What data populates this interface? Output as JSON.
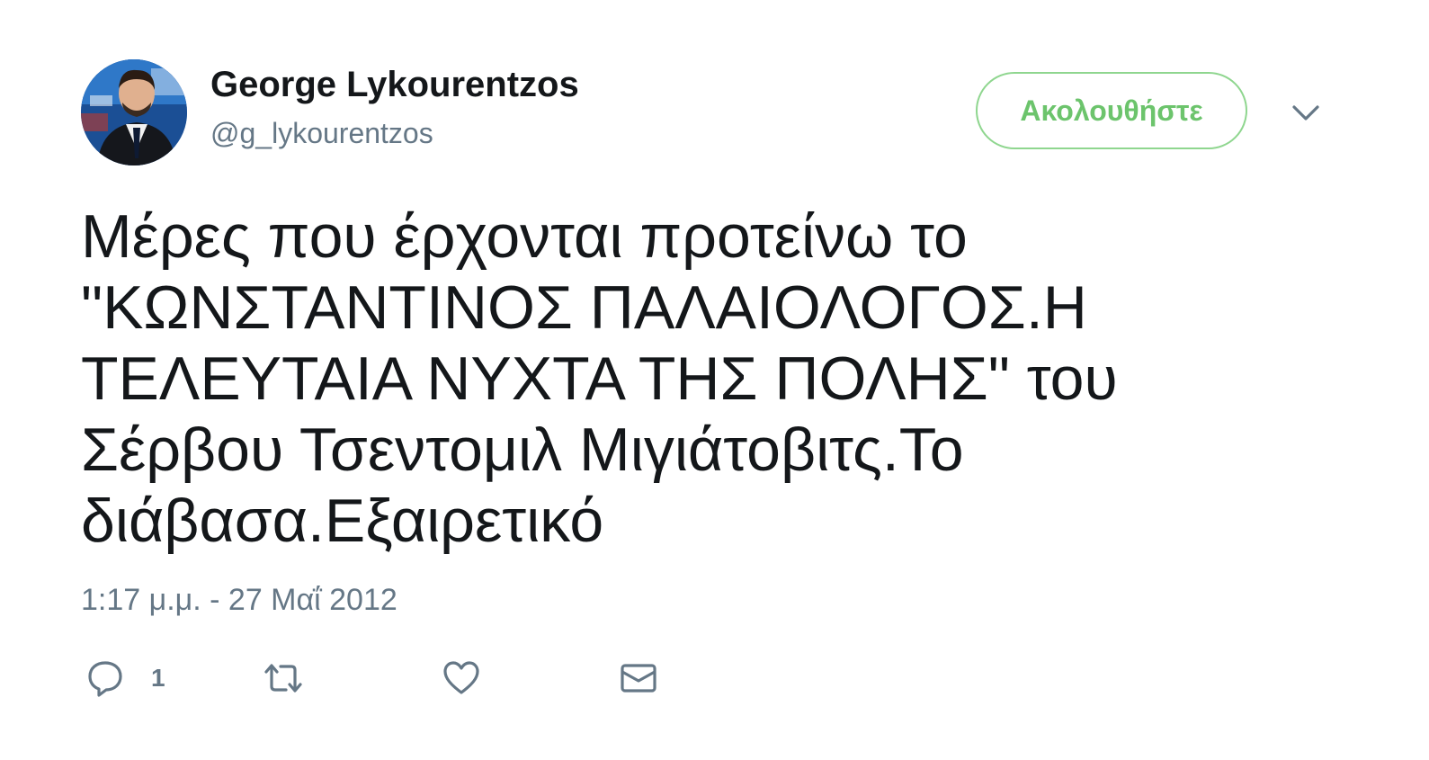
{
  "author": {
    "display_name": "George Lykourentzos",
    "handle": "@g_lykourentzos"
  },
  "header": {
    "follow_label": "Ακολουθήστε",
    "menu_icon": "chevron-down-icon"
  },
  "tweet": {
    "text": "Μέρες που έρχονται προτείνω το\n\"ΚΩΝΣΤΑΝΤΙΝΟΣ ΠΑΛΑΙΟΛΟΓΟΣ.Η\nΤΕΛΕΥΤΑΙΑ ΝΥΧΤΑ ΤΗΣ ΠΟΛΗΣ\" του\nΣέρβου Τσεντομιλ Μιγιάτοβιτς.Το\nδιάβασα.Εξαιρετικό",
    "timestamp": "1:17 μ.μ. - 27 Μαΐ 2012"
  },
  "actions": {
    "reply_count": "1",
    "icons": [
      "reply-icon",
      "retweet-icon",
      "like-icon",
      "message-icon"
    ]
  },
  "colors": {
    "text": "#14171a",
    "secondary": "#657786",
    "follow_accent": "#6cc46c"
  }
}
